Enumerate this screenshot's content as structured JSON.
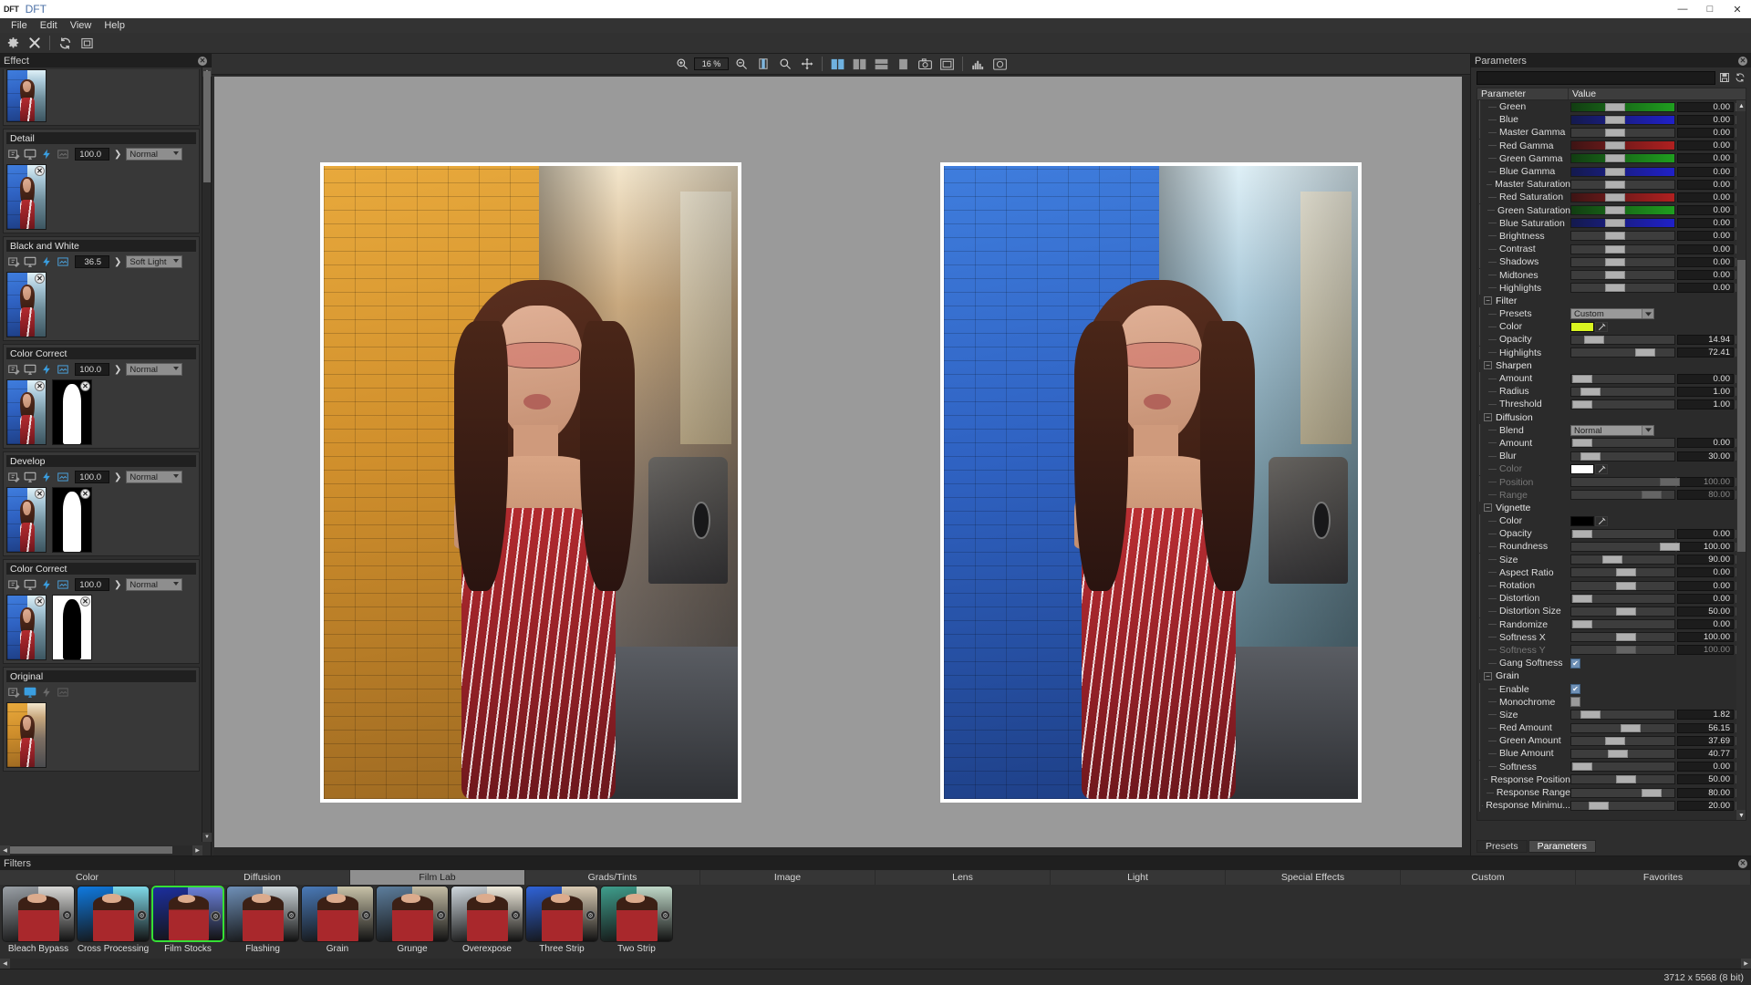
{
  "titlebar": {
    "logo": "DFT",
    "title": "DFT",
    "minimize": "—",
    "maximize": "□",
    "close": "✕"
  },
  "menubar": {
    "items": [
      {
        "label": "File"
      },
      {
        "label": "Edit"
      },
      {
        "label": "View"
      },
      {
        "label": "Help"
      }
    ]
  },
  "main_toolbar": {
    "icons": [
      "gear-icon",
      "close-x-icon",
      "refresh-icon",
      "fit-frame-icon"
    ]
  },
  "effect_panel": {
    "title": "Effect",
    "layers": [
      {
        "name": "",
        "opacity": "",
        "blend": "",
        "partial": true
      },
      {
        "name": "Detail",
        "opacity": "100.0",
        "blend": "Normal",
        "has_mask": false
      },
      {
        "name": "Black and White",
        "opacity": "36.5",
        "blend": "Soft Light",
        "has_mask": false
      },
      {
        "name": "Color Correct",
        "opacity": "100.0",
        "blend": "Normal",
        "has_mask": true,
        "mask": "white"
      },
      {
        "name": "Develop",
        "opacity": "100.0",
        "blend": "Normal",
        "has_mask": true,
        "mask": "white"
      },
      {
        "name": "Color Correct",
        "opacity": "100.0",
        "blend": "Normal",
        "has_mask": true,
        "mask": "black"
      },
      {
        "name": "Original",
        "opacity": "",
        "blend": "",
        "has_mask": false,
        "original": true
      }
    ]
  },
  "viewer": {
    "zoom_value": "16 %",
    "zoom_in_icon": "zoom-in-icon",
    "zoom_out_icon": "zoom-out-icon",
    "fit_icon": "fit-icon",
    "magnify_icon": "magnifier-icon",
    "pan_icon": "pan-move-icon",
    "split_icons": [
      "split-vertical-icon",
      "split-horizontal-icon",
      "stack-icon",
      "single-icon"
    ],
    "snapshot_icon": "camera-icon",
    "frame_icon": "frame-icon",
    "histogram_icon": "histogram-icon",
    "compare_icon": "compare-icon"
  },
  "parameters": {
    "title": "Parameters",
    "search_value": "",
    "columns": {
      "parameter": "Parameter",
      "value": "Value"
    },
    "save_icon": "save-preset-icon",
    "reset_icon": "reset-icon",
    "tabs": [
      {
        "label": "Presets",
        "active": false
      },
      {
        "label": "Parameters",
        "active": true
      }
    ],
    "rows": [
      {
        "kind": "slider",
        "name": "Green",
        "value": "0.00",
        "pos": 33,
        "track": "green",
        "dim": false
      },
      {
        "kind": "slider",
        "name": "Blue",
        "value": "0.00",
        "pos": 33,
        "track": "blue",
        "dim": false
      },
      {
        "kind": "slider",
        "name": "Master Gamma",
        "value": "0.00",
        "pos": 33,
        "track": "grey",
        "dim": false
      },
      {
        "kind": "slider",
        "name": "Red Gamma",
        "value": "0.00",
        "pos": 33,
        "track": "red",
        "dim": false
      },
      {
        "kind": "slider",
        "name": "Green Gamma",
        "value": "0.00",
        "pos": 33,
        "track": "green",
        "dim": false
      },
      {
        "kind": "slider",
        "name": "Blue Gamma",
        "value": "0.00",
        "pos": 33,
        "track": "blue",
        "dim": false
      },
      {
        "kind": "slider",
        "name": "Master Saturation",
        "value": "0.00",
        "pos": 33,
        "track": "grey",
        "dim": false
      },
      {
        "kind": "slider",
        "name": "Red Saturation",
        "value": "0.00",
        "pos": 33,
        "track": "red",
        "dim": false
      },
      {
        "kind": "slider",
        "name": "Green Saturation",
        "value": "0.00",
        "pos": 33,
        "track": "green",
        "dim": false
      },
      {
        "kind": "slider",
        "name": "Blue Saturation",
        "value": "0.00",
        "pos": 33,
        "track": "blue",
        "dim": false
      },
      {
        "kind": "slider",
        "name": "Brightness",
        "value": "0.00",
        "pos": 33,
        "track": "grey",
        "dim": false
      },
      {
        "kind": "slider",
        "name": "Contrast",
        "value": "0.00",
        "pos": 33,
        "track": "grey",
        "dim": false
      },
      {
        "kind": "slider",
        "name": "Shadows",
        "value": "0.00",
        "pos": 33,
        "track": "grey",
        "dim": false
      },
      {
        "kind": "slider",
        "name": "Midtones",
        "value": "0.00",
        "pos": 33,
        "track": "grey",
        "dim": false
      },
      {
        "kind": "slider",
        "name": "Highlights",
        "value": "0.00",
        "pos": 33,
        "track": "grey",
        "dim": false
      },
      {
        "kind": "group",
        "name": "Filter"
      },
      {
        "kind": "dropdown",
        "name": "Presets",
        "value": "Custom"
      },
      {
        "kind": "color",
        "name": "Color",
        "color": "#d9f520"
      },
      {
        "kind": "slider",
        "name": "Opacity",
        "value": "14.94",
        "pos": 12,
        "track": "grey",
        "dim": false
      },
      {
        "kind": "slider",
        "name": "Highlights",
        "value": "72.41",
        "pos": 62,
        "track": "grey",
        "dim": false
      },
      {
        "kind": "group",
        "name": "Sharpen"
      },
      {
        "kind": "slider",
        "name": "Amount",
        "value": "0.00",
        "pos": 1,
        "track": "grey",
        "dim": false
      },
      {
        "kind": "slider",
        "name": "Radius",
        "value": "1.00",
        "pos": 9,
        "track": "grey",
        "dim": false
      },
      {
        "kind": "slider",
        "name": "Threshold",
        "value": "1.00",
        "pos": 1,
        "track": "grey",
        "dim": false
      },
      {
        "kind": "group",
        "name": "Diffusion"
      },
      {
        "kind": "dropdown",
        "name": "Blend",
        "value": "Normal"
      },
      {
        "kind": "slider",
        "name": "Amount",
        "value": "0.00",
        "pos": 1,
        "track": "grey",
        "dim": false
      },
      {
        "kind": "slider",
        "name": "Blur",
        "value": "30.00",
        "pos": 9,
        "track": "grey",
        "dim": false
      },
      {
        "kind": "color",
        "name": "Color",
        "color": "#ffffff",
        "dim": true
      },
      {
        "kind": "slider",
        "name": "Position",
        "value": "100.00",
        "pos": 86,
        "track": "grey",
        "dim": true
      },
      {
        "kind": "slider",
        "name": "Range",
        "value": "80.00",
        "pos": 68,
        "track": "grey",
        "dim": true
      },
      {
        "kind": "group",
        "name": "Vignette"
      },
      {
        "kind": "color",
        "name": "Color",
        "color": "#000000"
      },
      {
        "kind": "slider",
        "name": "Opacity",
        "value": "0.00",
        "pos": 1,
        "track": "grey",
        "dim": false
      },
      {
        "kind": "slider",
        "name": "Roundness",
        "value": "100.00",
        "pos": 86,
        "track": "grey",
        "dim": false
      },
      {
        "kind": "slider",
        "name": "Size",
        "value": "90.00",
        "pos": 30,
        "track": "grey",
        "dim": false
      },
      {
        "kind": "slider",
        "name": "Aspect Ratio",
        "value": "0.00",
        "pos": 43,
        "track": "grey",
        "dim": false
      },
      {
        "kind": "slider",
        "name": "Rotation",
        "value": "0.00",
        "pos": 43,
        "track": "grey",
        "dim": false
      },
      {
        "kind": "slider",
        "name": "Distortion",
        "value": "0.00",
        "pos": 1,
        "track": "grey",
        "dim": false
      },
      {
        "kind": "slider",
        "name": "Distortion Size",
        "value": "50.00",
        "pos": 43,
        "track": "grey",
        "dim": false
      },
      {
        "kind": "slider",
        "name": "Randomize",
        "value": "0.00",
        "pos": 1,
        "track": "grey",
        "dim": false
      },
      {
        "kind": "slider",
        "name": "Softness X",
        "value": "100.00",
        "pos": 43,
        "track": "grey",
        "dim": false
      },
      {
        "kind": "slider",
        "name": "Softness Y",
        "value": "100.00",
        "pos": 43,
        "track": "grey",
        "dim": true
      },
      {
        "kind": "check",
        "name": "Gang Softness",
        "checked": true
      },
      {
        "kind": "group",
        "name": "Grain"
      },
      {
        "kind": "check",
        "name": "Enable",
        "checked": true
      },
      {
        "kind": "check",
        "name": "Monochrome",
        "checked": false
      },
      {
        "kind": "slider",
        "name": "Size",
        "value": "1.82",
        "pos": 9,
        "track": "grey",
        "dim": false
      },
      {
        "kind": "slider",
        "name": "Red Amount",
        "value": "56.15",
        "pos": 48,
        "track": "grey",
        "dim": false
      },
      {
        "kind": "slider",
        "name": "Green Amount",
        "value": "37.69",
        "pos": 33,
        "track": "grey",
        "dim": false
      },
      {
        "kind": "slider",
        "name": "Blue Amount",
        "value": "40.77",
        "pos": 35,
        "track": "grey",
        "dim": false
      },
      {
        "kind": "slider",
        "name": "Softness",
        "value": "0.00",
        "pos": 1,
        "track": "grey",
        "dim": false
      },
      {
        "kind": "slider",
        "name": "Response Position",
        "value": "50.00",
        "pos": 43,
        "track": "grey",
        "dim": false
      },
      {
        "kind": "slider",
        "name": "Response Range",
        "value": "80.00",
        "pos": 68,
        "track": "grey",
        "dim": false
      },
      {
        "kind": "slider",
        "name": "Response Minimu...",
        "value": "20.00",
        "pos": 17,
        "track": "grey",
        "dim": false
      }
    ]
  },
  "filters": {
    "title": "Filters",
    "categories": [
      {
        "label": "Color",
        "active": false
      },
      {
        "label": "Diffusion",
        "active": false
      },
      {
        "label": "Film Lab",
        "active": true
      },
      {
        "label": "Grads/Tints",
        "active": false
      },
      {
        "label": "Image",
        "active": false
      },
      {
        "label": "Lens",
        "active": false
      },
      {
        "label": "Light",
        "active": false
      },
      {
        "label": "Special Effects",
        "active": false
      },
      {
        "label": "Custom",
        "active": false
      },
      {
        "label": "Favorites",
        "active": false
      }
    ],
    "items": [
      {
        "label": "Bleach Bypass",
        "selected": false,
        "wall": "#9aa0a6",
        "alley": "#d8d8d6"
      },
      {
        "label": "Cross Processing",
        "selected": false,
        "wall": "#0f7ae0",
        "alley": "#7fd9e8"
      },
      {
        "label": "Film Stocks",
        "selected": true,
        "wall": "#1c2f9e",
        "alley": "#6a7fd8"
      },
      {
        "label": "Flashing",
        "selected": false,
        "wall": "#6f90b8",
        "alley": "#cdd6da"
      },
      {
        "label": "Grain",
        "selected": false,
        "wall": "#4a7ab8",
        "alley": "#c8c2a8"
      },
      {
        "label": "Grunge",
        "selected": false,
        "wall": "#5d7e9d",
        "alley": "#c3bca4"
      },
      {
        "label": "Overexpose",
        "selected": false,
        "wall": "#cfd7dd",
        "alley": "#efeadc"
      },
      {
        "label": "Three Strip",
        "selected": false,
        "wall": "#2f63d8",
        "alley": "#d9cbb4"
      },
      {
        "label": "Two Strip",
        "selected": false,
        "wall": "#3f9e8c",
        "alley": "#bfd8c8"
      }
    ]
  },
  "statusbar": {
    "image_info": "3712 x 5568 (8 bit)"
  }
}
